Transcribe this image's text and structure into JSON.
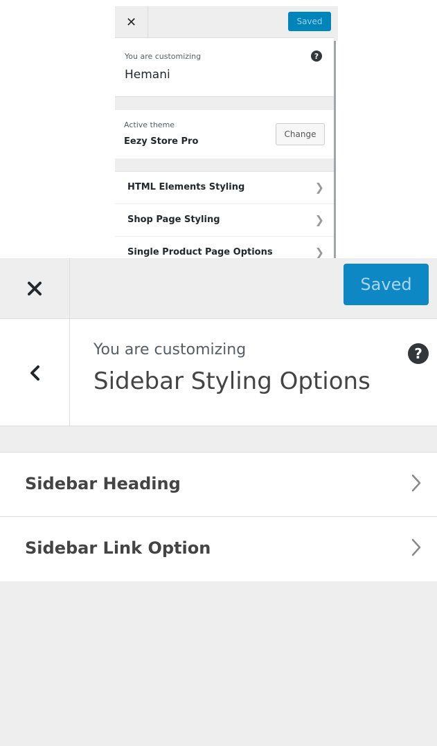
{
  "top_panel": {
    "saved_label": "Saved",
    "customizing_label": "You are customizing",
    "site_title": "Hemani",
    "help_glyph": "?",
    "active_theme_label": "Active theme",
    "theme_name": "Eezy Store Pro",
    "change_label": "Change",
    "sections": [
      {
        "label": "HTML Elements Styling"
      },
      {
        "label": "Shop Page Styling"
      },
      {
        "label": "Single Product Page Options"
      }
    ]
  },
  "main_panel": {
    "saved_label": "Saved",
    "customizing_label": "You are customizing",
    "section_title": "Sidebar Styling Options",
    "help_glyph": "?",
    "controls": [
      {
        "label": "Sidebar Heading"
      },
      {
        "label": "Sidebar Link Option"
      }
    ]
  },
  "colors": {
    "accent": "#0085ba",
    "panel_bg": "#eeeeee",
    "text": "#23282d"
  }
}
